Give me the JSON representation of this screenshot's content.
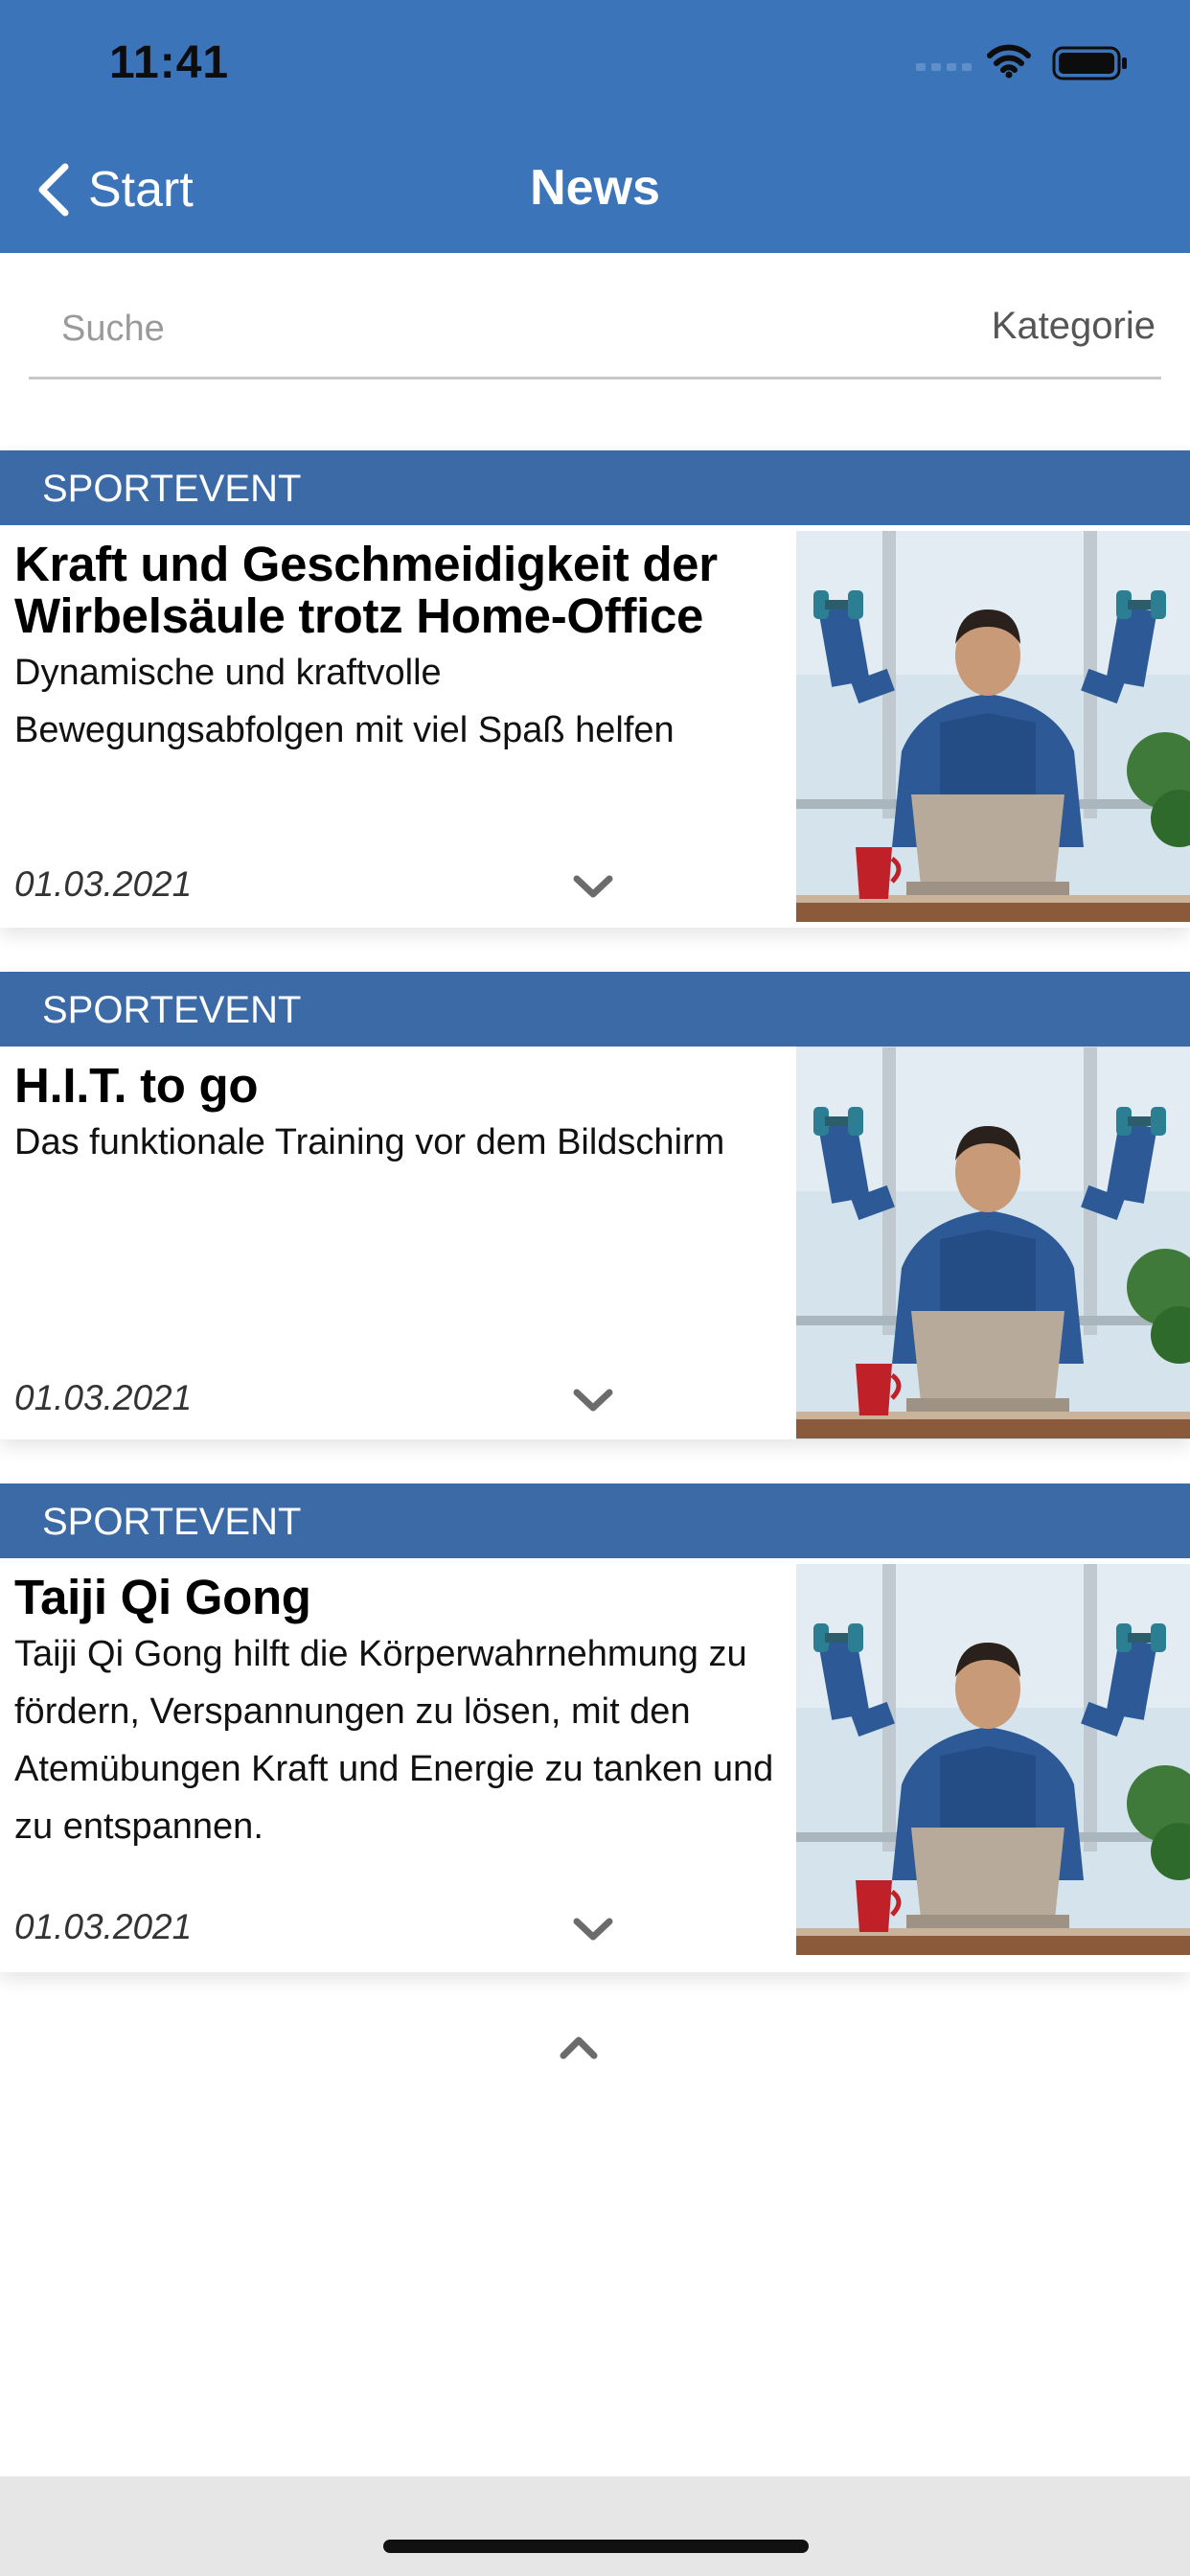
{
  "status_bar": {
    "time": "11:41"
  },
  "nav": {
    "back_label": "Start",
    "title": "News"
  },
  "search": {
    "placeholder": "Suche",
    "category_label": "Kategorie"
  },
  "colors": {
    "header": "#3c74ba",
    "category_bar": "#3b6aa7"
  },
  "news": [
    {
      "category": "SPORTEVENT",
      "title": "Kraft und Geschmeidigkeit der Wirbelsäule trotz Home-Office",
      "description": "Dynamische und kraftvolle Bewegungsabfolgen mit viel Spaß helfen",
      "date": "01.03.2021",
      "image": "man-with-dumbbells-at-laptop"
    },
    {
      "category": "SPORTEVENT",
      "title": "H.I.T. to go",
      "description": "Das funktionale Training vor dem Bildschirm",
      "date": "01.03.2021",
      "image": "man-with-dumbbells-at-laptop"
    },
    {
      "category": "SPORTEVENT",
      "title": "Taiji Qi Gong",
      "description": "Taiji Qi Gong hilft die Körperwahrnehmung zu fördern, Verspannungen zu lösen, mit den Atemübungen Kraft und Energie zu tanken und zu entspannen.",
      "date": "01.03.2021",
      "image": "man-with-dumbbells-at-laptop"
    }
  ],
  "icons": {
    "back": "chevron-left-icon",
    "expand": "chevron-down-icon",
    "collapse": "chevron-up-icon"
  }
}
